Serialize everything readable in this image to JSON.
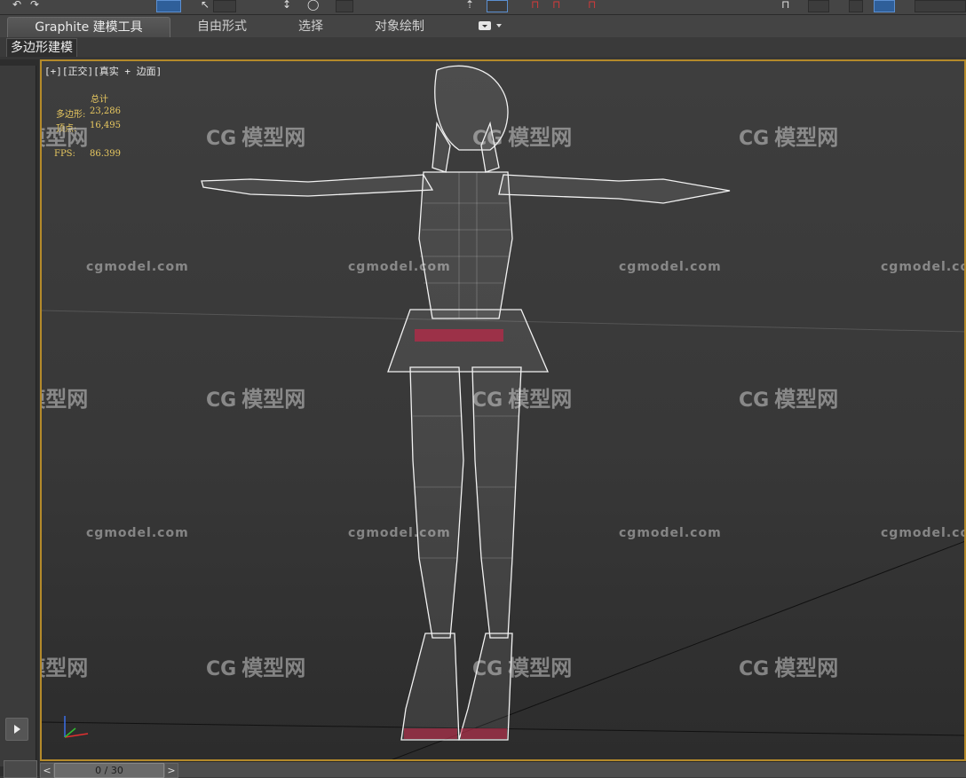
{
  "toolbar": {
    "items": [
      "undo-icon",
      "redo-icon",
      "select-icon",
      "rect-select-icon",
      "move-icon",
      "rotate-icon",
      "snap-icon",
      "mirror-icon",
      "align-icon",
      "layer-icon",
      "render-icon"
    ]
  },
  "ribbon": {
    "tabs": [
      {
        "label": "Graphite 建模工具",
        "active": true
      },
      {
        "label": "自由形式",
        "active": false
      },
      {
        "label": "选择",
        "active": false
      },
      {
        "label": "对象绘制",
        "active": false
      }
    ],
    "subtab_label": "多边形建模"
  },
  "viewport": {
    "label": "[+][正交][真实 + 边面]",
    "stats": {
      "total_label": "总计",
      "polys_label": "多边形:",
      "polys_value": "23,286",
      "verts_label": "顶点:",
      "verts_value": "16,495",
      "fps_label": "FPS:",
      "fps_value": "86.399"
    },
    "watermark_text": "cgmodel.com",
    "watermark_logo_cg": "CG",
    "watermark_logo_text": "模型网",
    "wireframe_color": "#f2f2f2",
    "accent_red": "#c02848",
    "border_color": "#b48a2a"
  },
  "timeline": {
    "prev": "<",
    "next": ">",
    "position": "0 / 30"
  }
}
